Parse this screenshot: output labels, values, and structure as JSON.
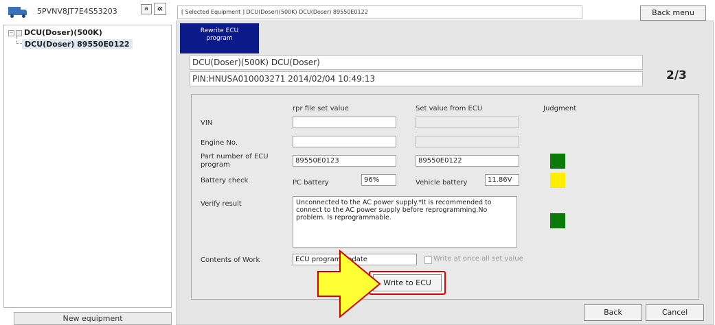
{
  "left_panel": {
    "vin": "5PVNV8JT7E4S53203",
    "a_button": "a",
    "collapse_icon": "«",
    "tree": {
      "root_label": "DCU(Doser)(500K)",
      "child_label": "DCU(Doser) 89550E0122"
    },
    "new_equipment": "New equipment"
  },
  "top_bar": {
    "selected_equipment": "[ Selected Equipment ] DCU(Doser)(500K) DCU(Doser) 89550E0122",
    "back_menu": "Back menu"
  },
  "tab": {
    "line1": "Rewrite ECU",
    "line2": "program"
  },
  "header": {
    "equipment": "DCU(Doser)(500K) DCU(Doser)",
    "pin": "PIN:HNUSA010003271 2014/02/04 10:49:13",
    "step": "2/3"
  },
  "form": {
    "col_rpr": "rpr file set value",
    "col_ecu": "Set value from ECU",
    "col_judgment": "Judgment",
    "vin_label": "VIN",
    "vin_rpr": "",
    "vin_ecu": "",
    "engine_label": "Engine No.",
    "engine_rpr": "",
    "engine_ecu": "",
    "part_label": "Part number of ECU program",
    "part_rpr": "89550E0123",
    "part_ecu": "89550E0122",
    "battery_label": "Battery check",
    "pc_battery_label": "PC battery",
    "pc_battery_value": "96%",
    "vehicle_battery_label": "Vehicle battery",
    "vehicle_battery_value": "11.86V",
    "verify_label": "Verify result",
    "verify_text": "Unconnected to the AC power supply.*It is recommended to connect to the AC power supply before reprogramming.No problem. Is reprogrammable.",
    "contents_label": "Contents of Work",
    "contents_value": "ECU program update",
    "write_all_label": "Write at once all set value",
    "write_button": "Write to ECU"
  },
  "judgments": {
    "part_color": "#0a7a0a",
    "battery_color": "#ffee00",
    "verify_color": "#0a7a0a"
  },
  "footer": {
    "back": "Back",
    "cancel": "Cancel"
  },
  "colors": {
    "tab_bg": "#0b1a88",
    "highlight": "#e00000",
    "arrow_fill": "#ffff33"
  }
}
